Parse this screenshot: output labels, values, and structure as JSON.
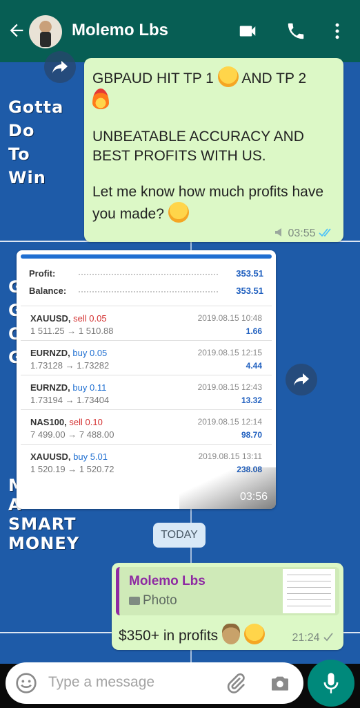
{
  "header": {
    "contact_name": "Molemo Lbs"
  },
  "wallpaper": {
    "lines_top": [
      "Gotta",
      "Do",
      "To",
      "Win"
    ],
    "lines_middle": [
      "G",
      "G",
      "O",
      "G"
    ],
    "lines_bottom": [
      "M",
      "A",
      "SMART",
      "MONEY"
    ]
  },
  "message1": {
    "line1": "GBPAUD HIT TP 1",
    "line1b": "AND TP 2",
    "para2": "UNBEATABLE ACCURACY AND BEST PROFITS WITH US.",
    "para3": "Let me know how much profits have you made?",
    "time": "03:55"
  },
  "report": {
    "profit_label": "Profit:",
    "profit_value": "353.51",
    "balance_label": "Balance:",
    "balance_value": "353.51",
    "trades": [
      {
        "symbol": "XAUUSD,",
        "direction": "sell 0.05",
        "type": "sell",
        "prices": "1 511.25 → 1 510.88",
        "date": "2019.08.15 10:48",
        "profit": "1.66"
      },
      {
        "symbol": "EURNZD,",
        "direction": "buy 0.05",
        "type": "buy",
        "prices": "1.73128 → 1.73282",
        "date": "2019.08.15 12:15",
        "profit": "4.44"
      },
      {
        "symbol": "EURNZD,",
        "direction": "buy 0.11",
        "type": "buy",
        "prices": "1.73194 → 1.73404",
        "date": "2019.08.15 12:43",
        "profit": "13.32"
      },
      {
        "symbol": "NAS100,",
        "direction": "sell 0.10",
        "type": "sell",
        "prices": "7 499.00 → 7 488.00",
        "date": "2019.08.15 12:14",
        "profit": "98.70"
      },
      {
        "symbol": "XAUUSD,",
        "direction": "buy 5.01",
        "type": "buy",
        "prices": "1 520.19 → 1 520.72",
        "date": "2019.08.15 13:11",
        "profit": "238.08"
      }
    ],
    "time": "03:56"
  },
  "date_chip": "TODAY",
  "message2": {
    "quote_name": "Molemo Lbs",
    "quote_type": "Photo",
    "text": "$350+ in profits",
    "time": "21:24"
  },
  "input": {
    "placeholder": "Type a message"
  },
  "colors": {
    "header": "#075e54",
    "bubble": "#dcf8c6",
    "mic": "#00897b",
    "quote_name": "#8e2aa2"
  },
  "icons": [
    "back-arrow-icon",
    "video-call-icon",
    "phone-icon",
    "more-options-icon",
    "forward-icon",
    "emoji-icon",
    "attach-icon",
    "camera-icon",
    "mic-icon",
    "double-check-icon",
    "single-check-icon"
  ]
}
